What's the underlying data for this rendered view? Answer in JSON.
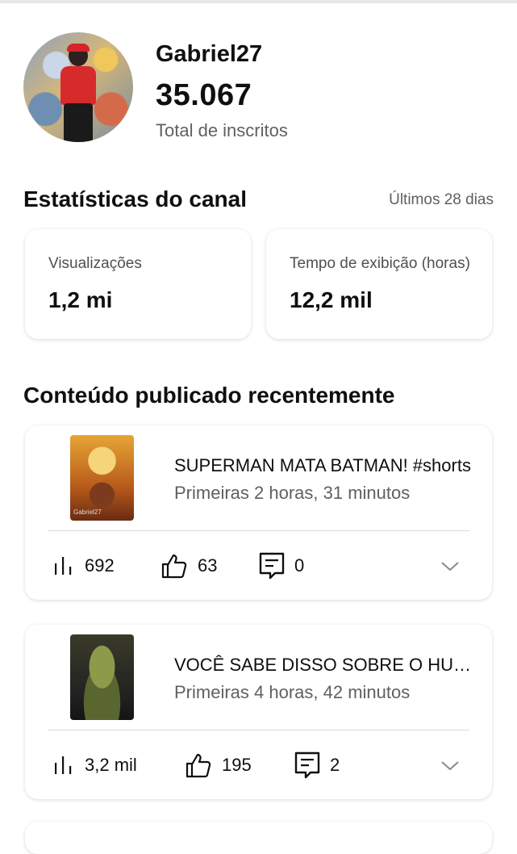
{
  "profile": {
    "username": "Gabriel27",
    "subscribers": "35.067",
    "subscribers_label": "Total de inscritos"
  },
  "stats": {
    "title": "Estatísticas do canal",
    "period": "Últimos 28 dias",
    "cards": [
      {
        "label": "Visualizações",
        "value": "1,2 mi"
      },
      {
        "label": "Tempo de exibição (horas)",
        "value": "12,2 mil"
      }
    ]
  },
  "recent": {
    "title": "Conteúdo publicado recentemente",
    "videos": [
      {
        "title": "SUPERMAN MATA BATMAN! #shorts",
        "time": "Primeiras 2 horas, 31 minutos",
        "views": "692",
        "likes": "63",
        "comments": "0",
        "thumb_text": "Gabriel27"
      },
      {
        "title": "VOCÊ SABE DISSO SOBRE O HULK?",
        "time": "Primeiras 4 horas, 42 minutos",
        "views": "3,2 mil",
        "likes": "195",
        "comments": "2",
        "thumb_text": ""
      }
    ]
  },
  "icons": {
    "views": "bar-chart-icon",
    "likes": "thumbs-up-icon",
    "comments": "comment-icon",
    "expand": "chevron-down-icon"
  },
  "colors": {
    "text": "#0f0f0f",
    "secondary": "#606060",
    "card_shadow": "#d9d9d9"
  }
}
